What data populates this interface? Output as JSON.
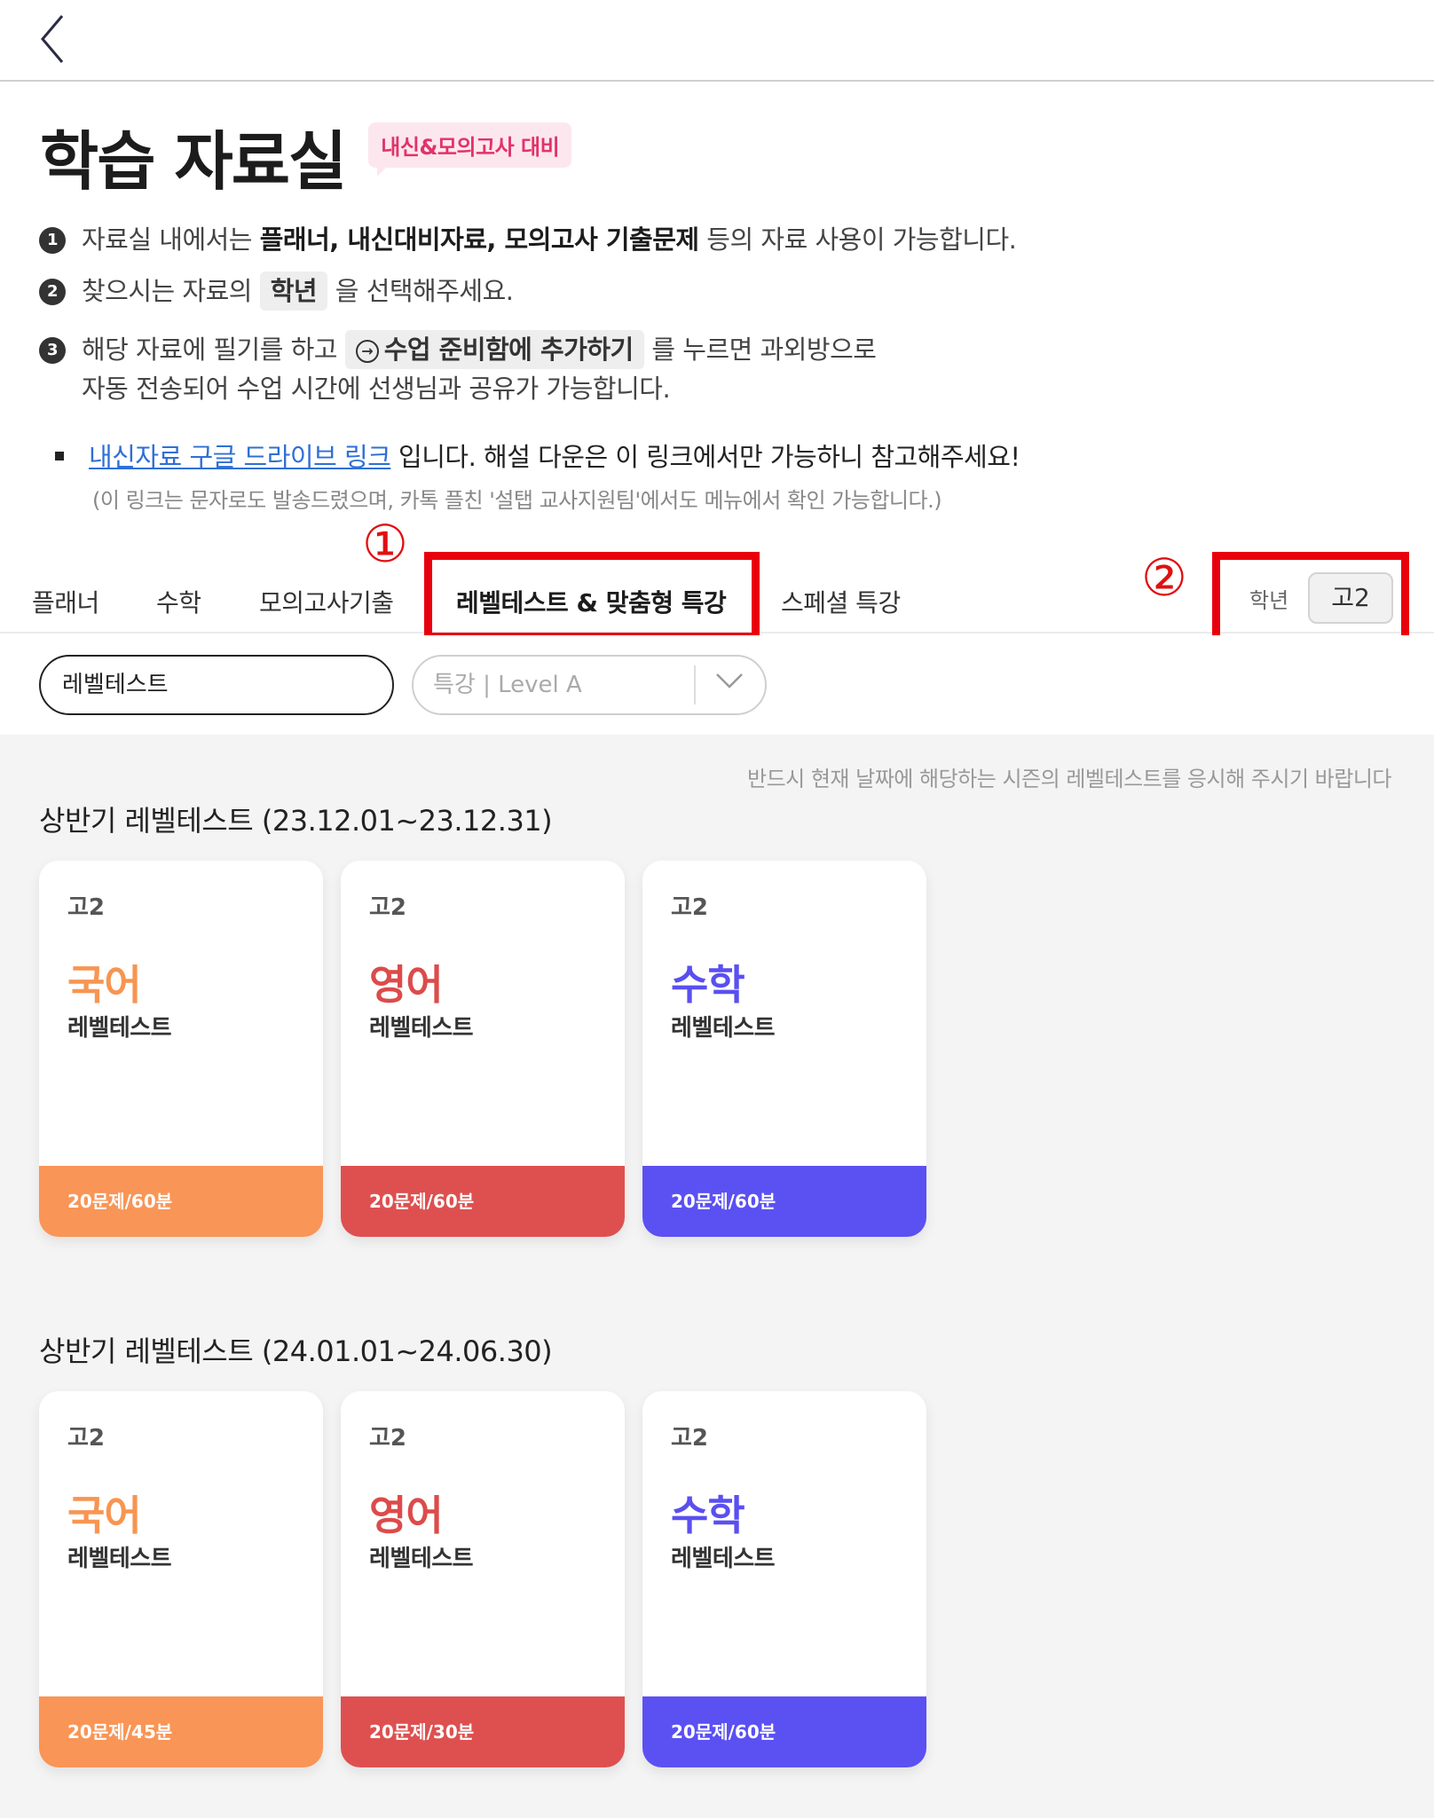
{
  "header": {
    "back_label": "<"
  },
  "hero": {
    "title": "학습 자료실",
    "badge": "내신&모의고사 대비"
  },
  "steps": {
    "s1": {
      "num": "1",
      "pre": "자료실 내에서는 ",
      "bold": "플래너, 내신대비자료, 모의고사 기출문제",
      "post": " 등의 자료 사용이 가능합니다."
    },
    "s2": {
      "num": "2",
      "pre": "찾으시는 자료의 ",
      "chip": "학년",
      "post": " 을 선택해주세요."
    },
    "s3": {
      "num": "3",
      "pre": "해당 자료에 필기를 하고 ",
      "chip": "수업 준비함에 추가하기",
      "post": " 를 누르면 과외방으로",
      "line2": "자동 전송되어 수업 시간에 선생님과 공유가 가능합니다."
    }
  },
  "drive": {
    "link": "내신자료 구글 드라이브 링크",
    "text": " 입니다. 해설 다운은 이 링크에서만 가능하니 참고해주세요!",
    "sub": "(이 링크는 문자로도 발송드렸으며, 카톡 플친 '설탭 교사지원팀'에서도 메뉴에서 확인 가능합니다.)"
  },
  "annotations": {
    "mark1": "①",
    "mark2": "②"
  },
  "tabs": [
    {
      "label": "플래너"
    },
    {
      "label": "수학"
    },
    {
      "label": "모의고사기출"
    },
    {
      "label": "레벨테스트 & 맞춤형 특강"
    },
    {
      "label": "스페셜 특강"
    }
  ],
  "grade": {
    "label": "학년",
    "value": "고2"
  },
  "filters": {
    "input_value": "레벨테스트",
    "select_value": "특강 | Level A"
  },
  "notice": "반드시 현재 날짜에 해당하는 시즌의 레벨테스트를 응시해 주시기 바랍니다",
  "sections": [
    {
      "title": "상반기 레벨테스트 (23.12.01~23.12.31)",
      "cards": [
        {
          "grade": "고2",
          "subject": "국어",
          "kind": "레벨테스트",
          "info": "20문제/60분",
          "color": "#f79552",
          "foot_color": "#f99556"
        },
        {
          "grade": "고2",
          "subject": "영어",
          "kind": "레벨테스트",
          "info": "20문제/60분",
          "color": "#dc4b4b",
          "foot_color": "#de5050"
        },
        {
          "grade": "고2",
          "subject": "수학",
          "kind": "레벨테스트",
          "info": "20문제/60분",
          "color": "#5a4ff0",
          "foot_color": "#5b50f2"
        }
      ]
    },
    {
      "title": "상반기 레벨테스트 (24.01.01~24.06.30)",
      "cards": [
        {
          "grade": "고2",
          "subject": "국어",
          "kind": "레벨테스트",
          "info": "20문제/45분",
          "color": "#f79552",
          "foot_color": "#f99556"
        },
        {
          "grade": "고2",
          "subject": "영어",
          "kind": "레벨테스트",
          "info": "20문제/30분",
          "color": "#dc4b4b",
          "foot_color": "#de5050"
        },
        {
          "grade": "고2",
          "subject": "수학",
          "kind": "레벨테스트",
          "info": "20문제/60분",
          "color": "#5a4ff0",
          "foot_color": "#5b50f2"
        }
      ]
    }
  ]
}
